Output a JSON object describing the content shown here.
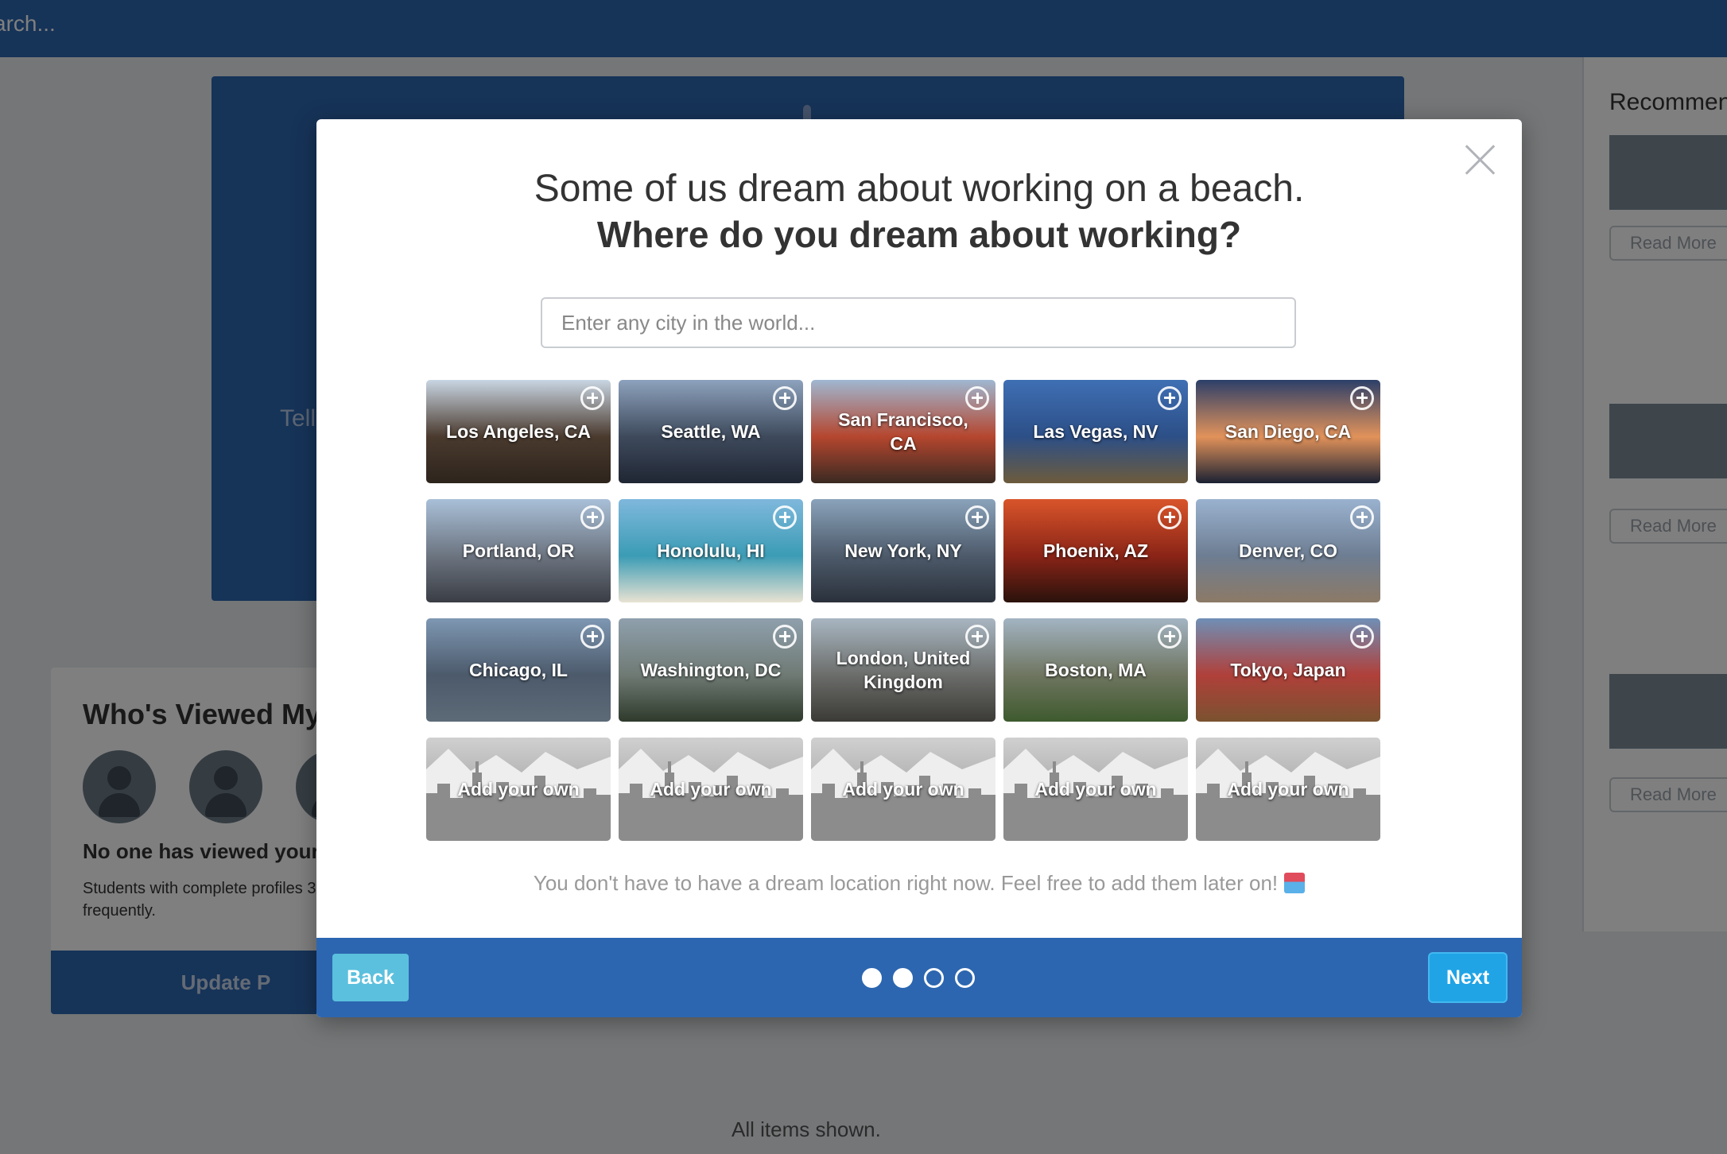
{
  "topbar": {
    "search_text": "arch..."
  },
  "background": {
    "hero_text": "Tell",
    "viewed_title": "Who's Viewed My P",
    "viewed_none": "No one has viewed your p",
    "viewed_hint": "Students with complete profiles 3x more frequently.",
    "update_label": "Update P",
    "recommended_title": "Recommen",
    "read_more": [
      "Read More",
      "Read More",
      "Read More"
    ],
    "all_items": "All items shown."
  },
  "modal": {
    "title_line1": "Some of us dream about working on a beach.",
    "title_line2": "Where do you dream about working?",
    "search_placeholder": "Enter any city in the world...",
    "note": "You don't have to have a dream location right now. Feel free to add them later on!",
    "note_emoji": "beach-umbrella-icon",
    "cities": [
      {
        "label": "Los Angeles, CA",
        "colors": [
          "#c9d6e3",
          "#4a3a2e",
          "#2d241c"
        ]
      },
      {
        "label": "Seattle, WA",
        "colors": [
          "#8da2bd",
          "#3e4a5c",
          "#1f2633"
        ]
      },
      {
        "label": "San Francisco, CA",
        "colors": [
          "#9fb7d1",
          "#b5462e",
          "#3a2a22"
        ]
      },
      {
        "label": "Las Vegas, NV",
        "colors": [
          "#3f6fb4",
          "#2c4f87",
          "#6d5b3c"
        ]
      },
      {
        "label": "San Diego, CA",
        "colors": [
          "#2c3f69",
          "#e2925a",
          "#1b2233"
        ]
      },
      {
        "label": "Portland, OR",
        "colors": [
          "#a9c0d8",
          "#6c7480",
          "#3a3d44"
        ]
      },
      {
        "label": "Honolulu, HI",
        "colors": [
          "#7fb8dc",
          "#3b9cb5",
          "#e8e2d2"
        ]
      },
      {
        "label": "New York, NY",
        "colors": [
          "#8aa3bb",
          "#4d5a6a",
          "#2a313b"
        ]
      },
      {
        "label": "Phoenix, AZ",
        "colors": [
          "#d9552a",
          "#8a2417",
          "#2a120c"
        ]
      },
      {
        "label": "Denver, CO",
        "colors": [
          "#9ab2cf",
          "#6d7d92",
          "#8c7a66"
        ]
      },
      {
        "label": "Chicago, IL",
        "colors": [
          "#7e97b3",
          "#4c5a6b",
          "#5d6a77"
        ]
      },
      {
        "label": "Washington, DC",
        "colors": [
          "#8fa0ad",
          "#6f7a74",
          "#2f3a2c"
        ]
      },
      {
        "label": "London, United Kingdom",
        "colors": [
          "#a8b6c2",
          "#6b6d6a",
          "#3b3a36"
        ]
      },
      {
        "label": "Boston, MA",
        "colors": [
          "#a3b4c3",
          "#6f7560",
          "#3e5a2e"
        ]
      },
      {
        "label": "Tokyo, Japan",
        "colors": [
          "#6f8fb6",
          "#b0403a",
          "#7a5230"
        ]
      },
      {
        "label": "Add your own",
        "colors": [
          "#d0d0d0",
          "#a9a9a9",
          "#8a8a8a"
        ]
      },
      {
        "label": "Add your own",
        "colors": [
          "#d0d0d0",
          "#a9a9a9",
          "#8a8a8a"
        ]
      },
      {
        "label": "Add your own",
        "colors": [
          "#d0d0d0",
          "#a9a9a9",
          "#8a8a8a"
        ]
      },
      {
        "label": "Add your own",
        "colors": [
          "#d0d0d0",
          "#a9a9a9",
          "#8a8a8a"
        ]
      },
      {
        "label": "Add your own",
        "colors": [
          "#d0d0d0",
          "#a9a9a9",
          "#8a8a8a"
        ]
      }
    ],
    "footer": {
      "back_label": "Back",
      "next_label": "Next",
      "steps_total": 4,
      "steps_completed": 2
    }
  },
  "colors": {
    "brand_blue": "#2c66b0",
    "back_button": "#5bc0de",
    "next_button": "#20a4e6"
  }
}
